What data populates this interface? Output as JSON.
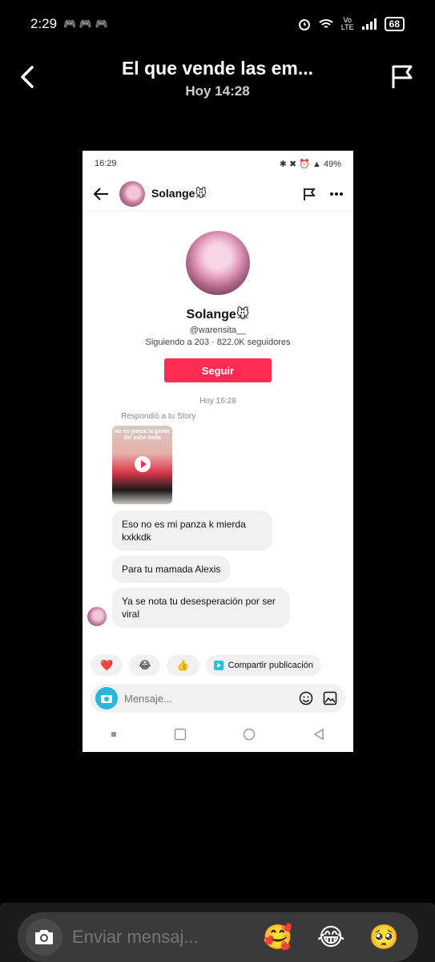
{
  "status_bar": {
    "time": "2:29",
    "left_icons": "🎮 🎮 🎮",
    "volte_top": "Vo",
    "volte_bottom": "LTE",
    "battery": "68"
  },
  "header": {
    "title": "El que vende las em...",
    "subtitle": "Hoy 14:28"
  },
  "screenshot": {
    "status": {
      "time": "16:29",
      "right": "✱ ✖ ⏰ ▲ 49%"
    },
    "chat_name": "Solange🐭",
    "profile": {
      "name": "Solange🐭",
      "handle": "@warensita__",
      "stats": "Siguiendo a 203 · 822.0K seguidores",
      "follow_label": "Seguir"
    },
    "timestamp": "Hoy 16:28",
    "reply_note": "Respondió a tu Story",
    "story_text": "no es panza la gente del sabe nada",
    "messages": [
      {
        "text": "Eso no es mi panza k mierda kxkkdk"
      },
      {
        "text": "Para tu mamada Alexis"
      },
      {
        "text": "Ya se nota tu desesperación por ser viral"
      }
    ],
    "reactions": {
      "heart": "❤️",
      "laugh": "😂",
      "thumbs": "👍",
      "share_label": "Compartir publicación"
    },
    "composer_placeholder": "Mensaje..."
  },
  "bottom_bar": {
    "placeholder": "Enviar mensaj...",
    "emojis": [
      "🥰",
      "😂",
      "🥺"
    ]
  }
}
